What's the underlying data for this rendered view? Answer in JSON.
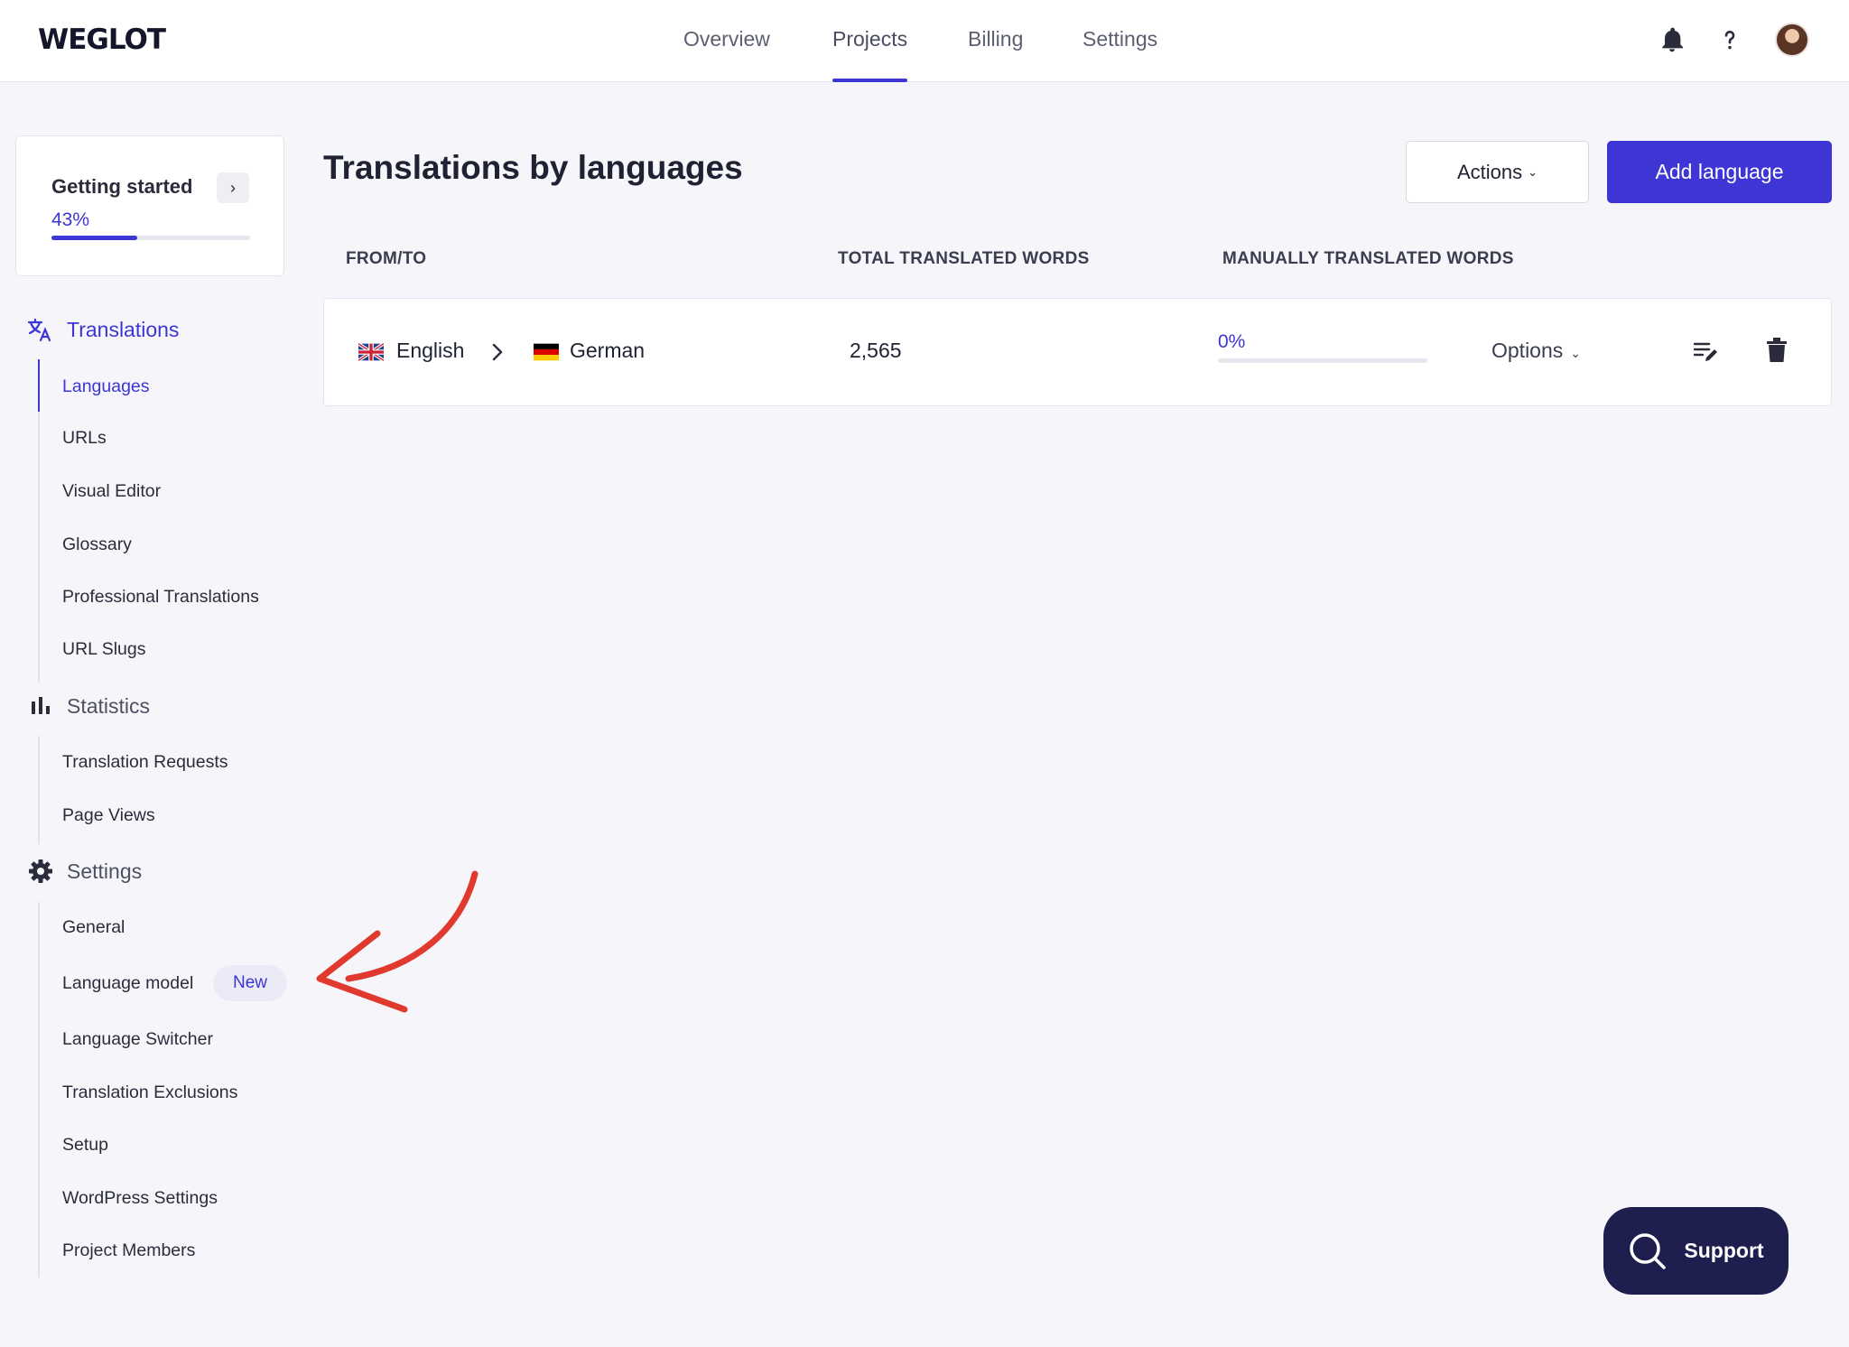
{
  "brand": {
    "logo_text": "WEGLOT",
    "accent_color": "#3d35d4",
    "annotation_color": "#e03a2e"
  },
  "topnav": {
    "items": [
      "Overview",
      "Projects",
      "Billing",
      "Settings"
    ],
    "active": "Projects",
    "icons": [
      "bell-icon",
      "help-icon",
      "avatar"
    ]
  },
  "getting_started": {
    "title": "Getting started",
    "percent_label": "43%",
    "progress": 0.43
  },
  "sidebar": {
    "translations": {
      "label": "Translations",
      "icon": "translate-icon",
      "items": [
        "Languages",
        "URLs",
        "Visual Editor",
        "Glossary",
        "Professional Translations",
        "URL Slugs"
      ],
      "active_item": "Languages"
    },
    "statistics": {
      "label": "Statistics",
      "icon": "bar-chart-icon",
      "items": [
        "Translation Requests",
        "Page Views"
      ]
    },
    "settings": {
      "label": "Settings",
      "icon": "gear-icon",
      "items": [
        "General",
        "Language model",
        "Language Switcher",
        "Translation Exclusions",
        "Setup",
        "WordPress Settings",
        "Project Members"
      ],
      "new_badge": "New"
    }
  },
  "main": {
    "title": "Translations by languages",
    "actions_label": "Actions",
    "add_language_label": "Add language",
    "columns": [
      "FROM/TO",
      "TOTAL TRANSLATED WORDS",
      "MANUALLY TRANSLATED WORDS"
    ],
    "rows": [
      {
        "from": "English",
        "to": "German",
        "total_words": "2,565",
        "manual_percent_label": "0%",
        "manual_progress": 0.0,
        "options_label": "Options"
      }
    ]
  },
  "support": {
    "label": "Support",
    "icon": "search-icon"
  }
}
